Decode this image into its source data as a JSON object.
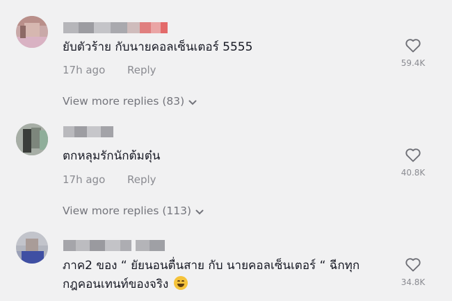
{
  "comments": [
    {
      "text": "ยับตัวร้าย กับนายคอลเซ็นเตอร์ 5555",
      "time": "17h ago",
      "reply_label": "Reply",
      "likes": "59.4K",
      "view_more": "View more replies (83)"
    },
    {
      "text": "ตกหลุมรักนักต้มตุ๋น",
      "time": "17h ago",
      "reply_label": "Reply",
      "likes": "40.8K",
      "view_more": "View more replies (113)"
    },
    {
      "text_line1": "ภาค2 ของ “ ยัยนอนตื่นสาย กับ นายคอลเซ็นเตอร์ “ ฉีกทุก",
      "text_line2": "กฎคอนเทนท์ของจริง",
      "emoji": "grinning-sweat-emoji",
      "likes": "34.8K"
    }
  ],
  "icons": {
    "like": "heart-outline-icon",
    "expand": "chevron-down-icon"
  },
  "colors": {
    "background": "#f1f1f2",
    "text": "#161823",
    "muted": "#8a8b91"
  }
}
